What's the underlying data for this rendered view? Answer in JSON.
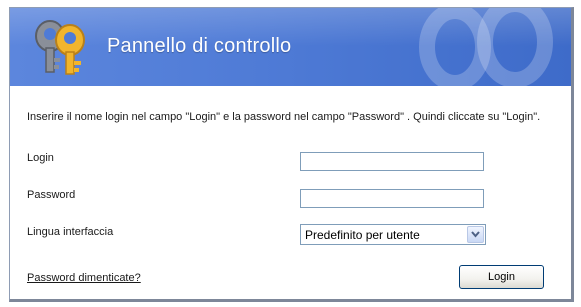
{
  "header": {
    "title": "Pannello di controllo",
    "colors": {
      "gradient_start": "#5c86dd",
      "gradient_end": "#3e6bc9"
    }
  },
  "instructions": "Inserire il nome login nel campo \"Login\" e la password nel campo \"Password\" . Quindi cliccate su \"Login\".",
  "form": {
    "login": {
      "label": "Login",
      "value": ""
    },
    "password": {
      "label": "Password",
      "value": ""
    },
    "language": {
      "label": "Lingua interfaccia",
      "selected": "Predefinito per utente"
    }
  },
  "forgot_link": "Password dimenticate?",
  "login_button": "Login",
  "icons": [
    "keys-icon",
    "chevron-down-icon"
  ]
}
